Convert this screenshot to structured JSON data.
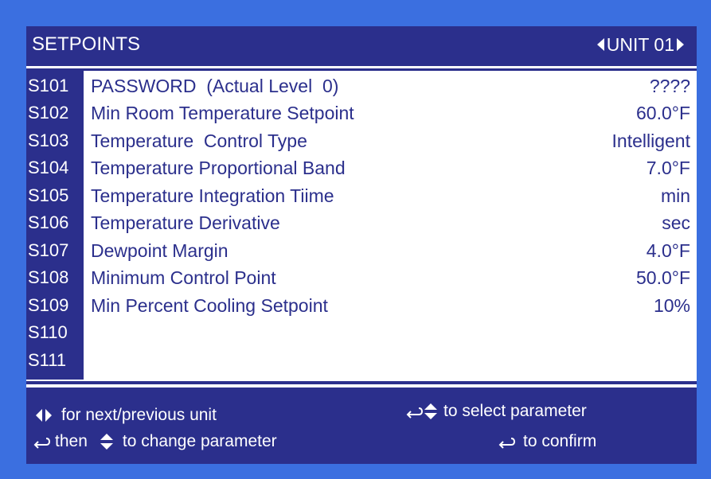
{
  "header": {
    "title": "SETPOINTS",
    "unit_label": "UNIT 01"
  },
  "parameters": [
    {
      "code": "S101",
      "label": "PASSWORD  (Actual Level  0)",
      "value": "????"
    },
    {
      "code": "S102",
      "label": "Min Room Temperature Setpoint",
      "value": "60.0°F"
    },
    {
      "code": "S103",
      "label": "Temperature  Control Type",
      "value": "Intelligent"
    },
    {
      "code": "S104",
      "label": "Temperature Proportional Band",
      "value": "7.0°F"
    },
    {
      "code": "S105",
      "label": "Temperature Integration Tiime",
      "value": "min"
    },
    {
      "code": "S106",
      "label": "Temperature Derivative",
      "value": "sec"
    },
    {
      "code": "S107",
      "label": "Dewpoint Margin",
      "value": "4.0°F"
    },
    {
      "code": "S108",
      "label": "Minimum Control Point",
      "value": "50.0°F"
    },
    {
      "code": "S109",
      "label": "Min Percent Cooling Setpoint",
      "value": "10%"
    },
    {
      "code": "S110",
      "label": "",
      "value": ""
    },
    {
      "code": "S111",
      "label": "",
      "value": ""
    }
  ],
  "footer": {
    "next_prev_text": "for next/previous unit",
    "change_then": "then",
    "change_text": "to change parameter",
    "select_text": "to select parameter",
    "confirm_text": "to confirm"
  },
  "colors": {
    "background": "#3b6fe0",
    "panel": "#ffffff",
    "accent": "#2b2f8c",
    "header_text": "#ffffff",
    "body_text": "#2b2f8c"
  },
  "icons": {
    "unit_prev": "triangle-left-icon",
    "unit_next": "triangle-right-icon",
    "enter": "enter-return-icon",
    "up_down": "up-down-arrows-icon"
  }
}
